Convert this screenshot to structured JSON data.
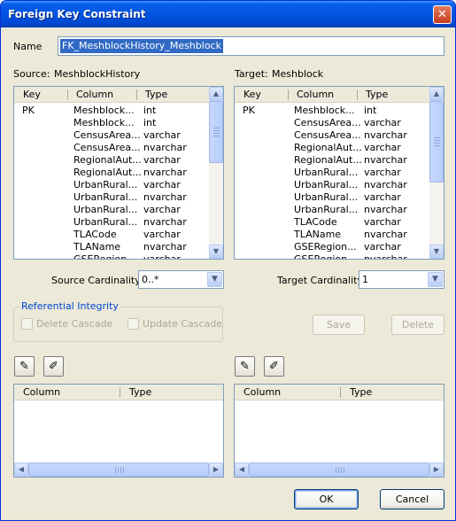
{
  "window": {
    "title": "Foreign Key Constraint",
    "close_glyph": "✕"
  },
  "name": {
    "label": "Name",
    "value": "FK_MeshblockHistory_Meshblock"
  },
  "source": {
    "label": "Source:",
    "table": "MeshblockHistory",
    "headers": [
      "Key",
      "Column",
      "Type"
    ],
    "rows": [
      {
        "key": "PK",
        "column": "Meshblock...",
        "type": "int"
      },
      {
        "key": "",
        "column": "Meshblock...",
        "type": "int"
      },
      {
        "key": "",
        "column": "CensusArea...",
        "type": "varchar"
      },
      {
        "key": "",
        "column": "CensusArea...",
        "type": "nvarchar"
      },
      {
        "key": "",
        "column": "RegionalAut...",
        "type": "varchar"
      },
      {
        "key": "",
        "column": "RegionalAut...",
        "type": "nvarchar"
      },
      {
        "key": "",
        "column": "UrbanRural...",
        "type": "varchar"
      },
      {
        "key": "",
        "column": "UrbanRural...",
        "type": "nvarchar"
      },
      {
        "key": "",
        "column": "UrbanRural...",
        "type": "varchar"
      },
      {
        "key": "",
        "column": "UrbanRural...",
        "type": "nvarchar"
      },
      {
        "key": "",
        "column": "TLACode",
        "type": "varchar"
      },
      {
        "key": "",
        "column": "TLAName",
        "type": "nvarchar"
      },
      {
        "key": "",
        "column": "GSERegion...",
        "type": "varchar"
      }
    ],
    "cardinality_label": "Source Cardinality:",
    "cardinality_value": "0..*"
  },
  "target": {
    "label": "Target:",
    "table": "Meshblock",
    "headers": [
      "Key",
      "Column",
      "Type"
    ],
    "rows": [
      {
        "key": "PK",
        "column": "Meshblock...",
        "type": "int"
      },
      {
        "key": "",
        "column": "CensusArea...",
        "type": "varchar"
      },
      {
        "key": "",
        "column": "CensusArea...",
        "type": "nvarchar"
      },
      {
        "key": "",
        "column": "RegionalAut...",
        "type": "varchar"
      },
      {
        "key": "",
        "column": "RegionalAut...",
        "type": "nvarchar"
      },
      {
        "key": "",
        "column": "UrbanRural...",
        "type": "varchar"
      },
      {
        "key": "",
        "column": "UrbanRural...",
        "type": "nvarchar"
      },
      {
        "key": "",
        "column": "UrbanRural...",
        "type": "varchar"
      },
      {
        "key": "",
        "column": "UrbanRural...",
        "type": "nvarchar"
      },
      {
        "key": "",
        "column": "TLACode",
        "type": "varchar"
      },
      {
        "key": "",
        "column": "TLAName",
        "type": "nvarchar"
      },
      {
        "key": "",
        "column": "GSERegion...",
        "type": "varchar"
      },
      {
        "key": "",
        "column": "GSERegion...",
        "type": "nvarchar"
      }
    ],
    "cardinality_label": "Target Cardinality:",
    "cardinality_value": "1"
  },
  "integrity": {
    "title": "Referential Integrity",
    "delete_cascade": "Delete Cascade",
    "update_cascade": "Update Cascade"
  },
  "buttons": {
    "save": "Save",
    "delete": "Delete",
    "ok": "OK",
    "cancel": "Cancel"
  },
  "mapping": {
    "source_headers": [
      "Column",
      "Type"
    ],
    "target_headers": [
      "Column",
      "Type"
    ]
  },
  "icons": {
    "add_column": "pencil-add-icon",
    "remove_column": "pencil-remove-icon",
    "scroll_up": "▲",
    "scroll_down": "▼",
    "scroll_left": "◀",
    "scroll_right": "▶",
    "drop": "▼"
  },
  "colors": {
    "titlebar": "#0054e3",
    "selection": "#316ac5",
    "group_title": "#0046d5"
  }
}
